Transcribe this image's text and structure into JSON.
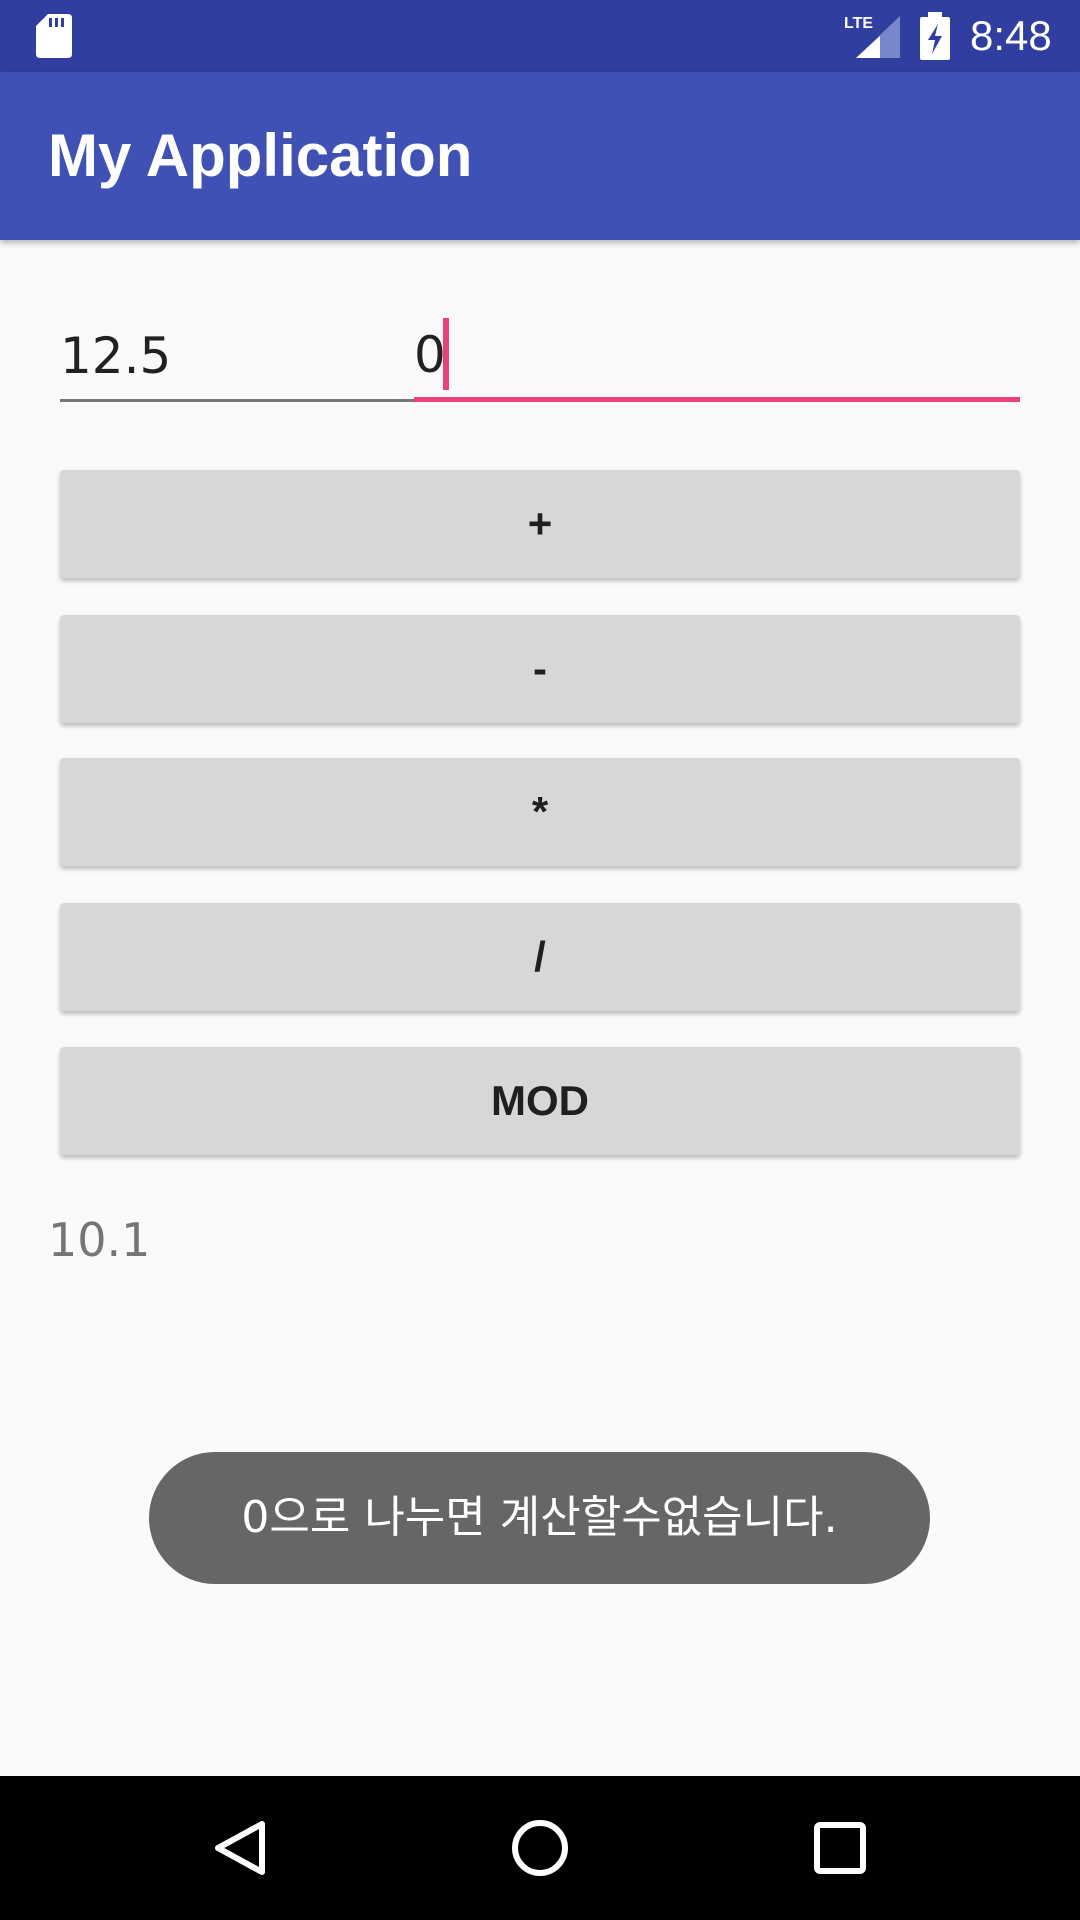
{
  "status_bar": {
    "time": "8:48",
    "network": "LTE",
    "icons": [
      "sd-card-icon",
      "lte-signal-icon",
      "battery-charging-icon"
    ]
  },
  "app_bar": {
    "title": "My Application"
  },
  "inputs": {
    "first_value": "12.5",
    "second_value": "0"
  },
  "buttons": {
    "add": "+",
    "subtract": "-",
    "multiply": "*",
    "divide": "/",
    "mod": "MOD"
  },
  "result": "10.1",
  "toast": {
    "message": "0으로 나누면 계산할수없습니다."
  },
  "nav_bar": {
    "icons": [
      "back-icon",
      "home-icon",
      "recents-icon"
    ]
  },
  "colors": {
    "status_bar": "#303f9f",
    "app_bar": "#3f51b5",
    "accent": "#ec407a",
    "button": "#d6d7d7",
    "toast": "#666666",
    "background": "#fafafa"
  }
}
